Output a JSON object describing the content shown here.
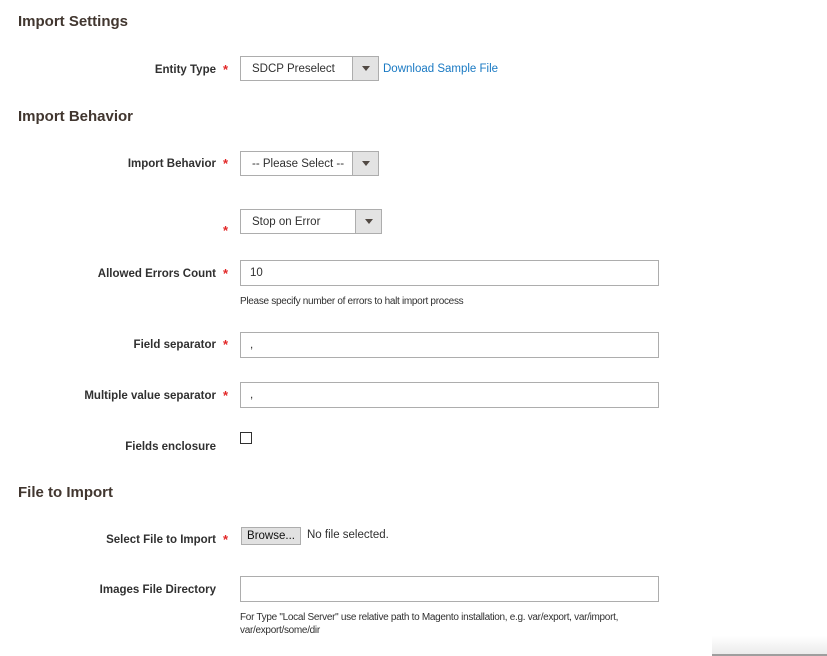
{
  "sections": {
    "import_settings": "Import Settings",
    "import_behavior": "Import Behavior",
    "file_to_import": "File to Import"
  },
  "entity_type": {
    "label": "Entity Type",
    "required": "*",
    "value": "SDCP Preselect",
    "link": "Download Sample File"
  },
  "import_behavior": {
    "label": "Import Behavior",
    "required": "*",
    "value": "-- Please Select --"
  },
  "validation_strategy": {
    "label": "",
    "required": "*",
    "value": "Stop on Error"
  },
  "allowed_errors": {
    "label": "Allowed Errors Count",
    "required": "*",
    "value": "10",
    "note": "Please specify number of errors to halt import process"
  },
  "field_separator": {
    "label": "Field separator",
    "required": "*",
    "value": ","
  },
  "multiple_value_separator": {
    "label": "Multiple value separator",
    "required": "*",
    "value": ","
  },
  "fields_enclosure": {
    "label": "Fields enclosure",
    "checked": false
  },
  "select_file": {
    "label": "Select File to Import",
    "required": "*",
    "browse_label": "Browse...",
    "status": "No file selected."
  },
  "images_dir": {
    "label": "Images File Directory",
    "value": "",
    "note_line1": "For Type \"Local Server\" use relative path to Magento installation, e.g. var/export, var/import,",
    "note_line2": "var/export/some/dir"
  }
}
